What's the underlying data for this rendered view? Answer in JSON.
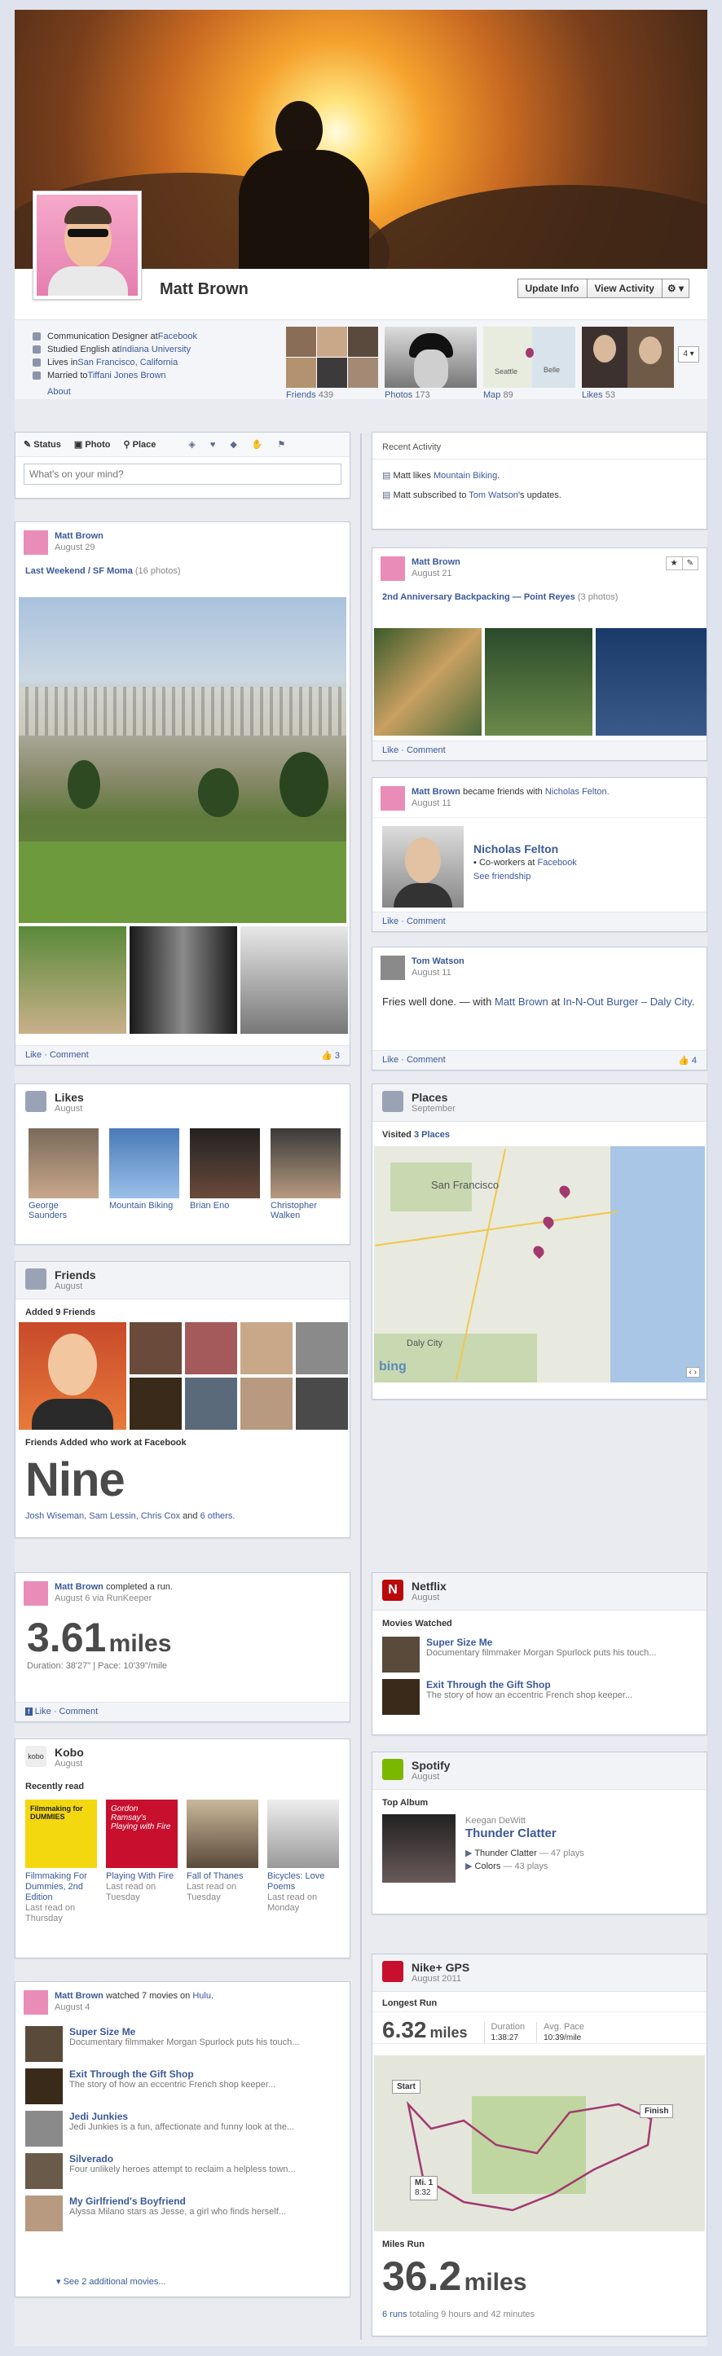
{
  "profile": {
    "name": "Matt Brown",
    "buttons": [
      "Update Info",
      "View Activity"
    ],
    "info": [
      {
        "pre": "Communication Designer at ",
        "link": "Facebook"
      },
      {
        "pre": "Studied English at ",
        "link": "Indiana University"
      },
      {
        "pre": "Lives in ",
        "link": "San Francisco, California"
      },
      {
        "pre": "Married to ",
        "link": "Tiffani Jones Brown"
      }
    ],
    "about": "About",
    "apps": [
      {
        "label": "Friends",
        "count": "439"
      },
      {
        "label": "Photos",
        "count": "173"
      },
      {
        "label": "Map",
        "count": "89"
      },
      {
        "label": "Likes",
        "count": "53"
      }
    ],
    "apps_more": "4"
  },
  "composer": {
    "tabs": [
      "Status",
      "Photo",
      "Place"
    ],
    "placeholder": "What's on your mind?"
  },
  "recent": {
    "title": "Recent Activity",
    "items": [
      {
        "pre": "Matt likes ",
        "link": "Mountain Biking",
        "post": "."
      },
      {
        "pre": "Matt subscribed to ",
        "link": "Tom Watson",
        "post": "'s updates."
      }
    ]
  },
  "post_sfmoma": {
    "name": "Matt Brown",
    "date": "August 29",
    "album": "Last Weekend / SF Moma",
    "count": "(16 photos)",
    "like": "Like",
    "comment": "Comment",
    "likes": "3"
  },
  "post_backpacking": {
    "name": "Matt Brown",
    "date": "August 21",
    "album": "2nd Anniversary Backpacking — Point Reyes",
    "count": "(3 photos)",
    "like": "Like",
    "comment": "Comment"
  },
  "post_friends": {
    "name": "Matt Brown",
    "action": " became friends with ",
    "friend": "Nicholas Felton.",
    "date": "August 11",
    "fname": "Nicholas Felton",
    "fsub_pre": "Co-workers at ",
    "fsub_link": "Facebook",
    "see": "See friendship",
    "like": "Like",
    "comment": "Comment"
  },
  "post_tom": {
    "name": "Tom Watson",
    "date": "August 11",
    "text_pre": "Fries well done. — with ",
    "text_link1": "Matt Brown",
    "text_mid": " at ",
    "text_link2": "In-N-Out Burger – Daly City",
    "text_post": ".",
    "like": "Like",
    "comment": "Comment",
    "likes": "4"
  },
  "likes_box": {
    "title": "Likes",
    "sub": "August",
    "items": [
      "George Saunders",
      "Mountain Biking",
      "Brian Eno",
      "Christopher Walken"
    ]
  },
  "places_box": {
    "title": "Places",
    "sub": "September",
    "visited_pre": "Visited ",
    "visited_link": "3 Places",
    "map_labels": [
      "San Francisco",
      "Daly City",
      "bing"
    ]
  },
  "friends_box": {
    "title": "Friends",
    "sub": "August",
    "added": "Added 9 Friends",
    "work_title": "Friends Added who work at Facebook",
    "big": "Nine",
    "names": "Josh Wiseman, Sam Lessin, Chris Cox",
    "and": " and ",
    "others": "6 others."
  },
  "run_post": {
    "name": "Matt Brown",
    "action": " completed a run.",
    "date": "August 6 via RunKeeper",
    "value": "3.61",
    "unit": "miles",
    "stats": "Duration: 38'27\" | Pace: 10'39\"/mile",
    "like": "Like",
    "comment": "Comment"
  },
  "netflix": {
    "title": "Netflix",
    "sub": "August",
    "section": "Movies Watched",
    "items": [
      {
        "title": "Super Size Me",
        "desc": "Documentary filmmaker Morgan Spurlock puts his touch..."
      },
      {
        "title": "Exit Through the Gift Shop",
        "desc": "The story of how an eccentric French shop keeper..."
      }
    ]
  },
  "kobo": {
    "title": "Kobo",
    "sub": "August",
    "section": "Recently read",
    "books": [
      {
        "title": "Filmmaking For Dummies, 2nd Edition",
        "when": "Last read on Thursday",
        "cover": "Filmmaking for DUMMIES"
      },
      {
        "title": "Playing With Fire",
        "when": "Last read on Tuesday",
        "cover": "Gordon Ramsay's Playing with Fire"
      },
      {
        "title": "Fall of Thanes",
        "when": "Last read on Tuesday",
        "cover": ""
      },
      {
        "title": "Bicycles: Love Poems",
        "when": "Last read on Monday",
        "cover": ""
      }
    ]
  },
  "spotify": {
    "title": "Spotify",
    "sub": "August",
    "section": "Top Album",
    "artist": "Keegan DeWitt",
    "album": "Thunder Clatter",
    "tracks": [
      {
        "name": "Thunder Clatter",
        "plays": "— 47 plays"
      },
      {
        "name": "Colors",
        "plays": "— 43 plays"
      }
    ]
  },
  "hulu": {
    "name": "Matt Brown",
    "action_pre": " watched 7 movies on ",
    "action_link": "Hulu",
    "action_post": ".",
    "date": "August 4",
    "items": [
      {
        "title": "Super Size Me",
        "desc": "Documentary filmmaker Morgan Spurlock puts his touch..."
      },
      {
        "title": "Exit Through the Gift Shop",
        "desc": "The story of how an eccentric French shop keeper..."
      },
      {
        "title": "Jedi Junkies",
        "desc": "Jedi Junkies is a fun, affectionate and funny look at the..."
      },
      {
        "title": "Silverado",
        "desc": "Four unlikely heroes attempt to reclaim a helpless town..."
      },
      {
        "title": "My Girlfriend's Boyfriend",
        "desc": "Alyssa Milano stars as Jesse, a girl who finds herself..."
      }
    ],
    "more": "See 2 additional movies..."
  },
  "nike": {
    "title": "Nike+ GPS",
    "sub": "August 2011",
    "section": "Longest Run",
    "value": "6.32",
    "unit": "miles",
    "duration_label": "Duration",
    "duration": "1:38:27",
    "pace_label": "Avg. Pace",
    "pace": "10:39/mile",
    "map": {
      "start": "Start",
      "finish": "Finish",
      "mile": "Mi. 1",
      "mile_time": "8:32"
    },
    "total_label": "Miles Run",
    "total": "36.2",
    "total_unit": "miles",
    "runs_link": "6 runs",
    "runs_rest": " totaling 9 hours and 42 minutes"
  },
  "colors": {
    "link": "#3b5998",
    "background": "#dfe3ee",
    "nike_red": "#a2396f"
  }
}
